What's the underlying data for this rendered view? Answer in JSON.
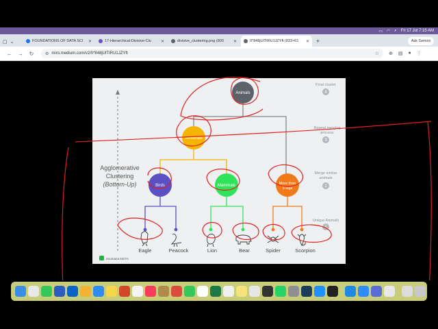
{
  "menubar": {
    "status_right": "Fri 17 Jul  7:15 AM"
  },
  "tabs": [
    {
      "label": "FOUNDATIONS OF DATA SCI",
      "color": "#1a73e8"
    },
    {
      "label": "17-Hierarchical-Divisive-Clu",
      "color": "#6b4fbb"
    },
    {
      "label": "divisive_clustering.png (800",
      "color": "#5f6368"
    },
    {
      "label": "0*848jUlTIRU1JZYft (833×61",
      "color": "#5f6368"
    }
  ],
  "toolbar": {
    "ask_gemini": "Ask Gemini",
    "url": "miro.medium.com/v2/0*848jUlTIRU1JZYft"
  },
  "diagram": {
    "side_title_line1": "Agglomerative",
    "side_title_line2": "Clustering",
    "side_title_line3": "(Bottom-Up)",
    "root": "Animals",
    "vertebrate": "Vertebrate",
    "birds": "Birds",
    "mammals": "Mammals",
    "legs_line1": "More than",
    "legs_line2": "3 legs",
    "leaves": [
      "Eagle",
      "Peacock",
      "Lion",
      "Bear",
      "Spider",
      "Scorpion"
    ],
    "steps": [
      {
        "label": "Final cluster",
        "num": "4"
      },
      {
        "label_line1": "Repeat merging",
        "label_line2": "process",
        "num": "3"
      },
      {
        "label_line1": "Merge similar",
        "label_line2": "animals",
        "num": "2"
      },
      {
        "label": "Unique Animals",
        "num": "1"
      }
    ],
    "brand": "Zoumana KEITA",
    "colors": {
      "root": "#5d6168",
      "vertebrate": "#f5b400",
      "birds": "#5b4fc4",
      "mammals": "#2fe35a",
      "legs": "#f07a1a",
      "annotation": "#e02020"
    }
  }
}
